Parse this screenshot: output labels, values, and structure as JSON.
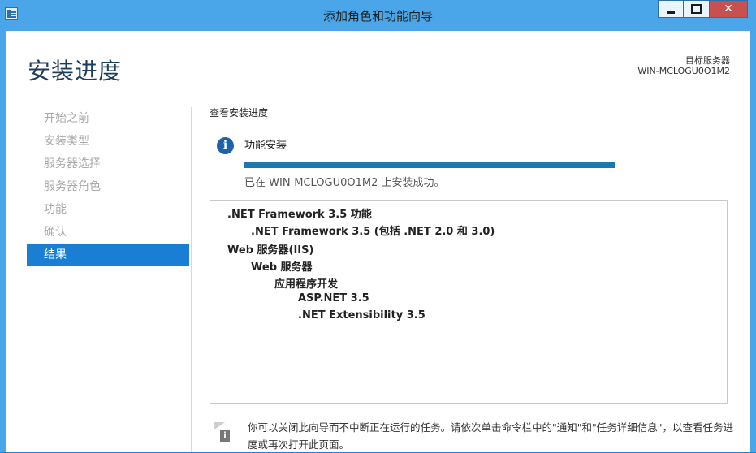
{
  "window": {
    "title": "添加角色和功能向导",
    "close_glyph": "✕"
  },
  "header": {
    "page_title": "安装进度",
    "destination_label": "目标服务器",
    "destination_value": "WIN-MCLOGU0O1M2"
  },
  "nav": {
    "items": [
      {
        "label": "开始之前",
        "active": false
      },
      {
        "label": "安装类型",
        "active": false
      },
      {
        "label": "服务器选择",
        "active": false
      },
      {
        "label": "服务器角色",
        "active": false
      },
      {
        "label": "功能",
        "active": false
      },
      {
        "label": "确认",
        "active": false
      },
      {
        "label": "结果",
        "active": true
      }
    ]
  },
  "main": {
    "section_header": "查看安装进度",
    "info_glyph": "i",
    "feature_label": "功能安装",
    "progress_percent": 100,
    "status_text": "已在 WIN-MCLOGU0O1M2 上安装成功。",
    "results": [
      {
        "text": ".NET Framework 3.5 功能",
        "level": 0
      },
      {
        "text": ".NET Framework 3.5 (包括 .NET 2.0 和 3.0)",
        "level": 1
      },
      {
        "text": "Web 服务器(IIS)",
        "level": 0
      },
      {
        "text": "Web 服务器",
        "level": 1
      },
      {
        "text": "应用程序开发",
        "level": 2
      },
      {
        "text": "ASP.NET 3.5",
        "level": 3
      },
      {
        "text": ".NET Extensibility 3.5",
        "level": 3
      }
    ],
    "note_glyph": "i",
    "note_text": "你可以关闭此向导而不中断正在运行的任务。请依次单击命令栏中的\"通知\"和\"任务详细信息\"，以查看任务进度或再次打开此页面。"
  },
  "colors": {
    "title_bar": "#4aa6e8",
    "accent": "#1a7fd4",
    "progress": "#1e78b0"
  }
}
